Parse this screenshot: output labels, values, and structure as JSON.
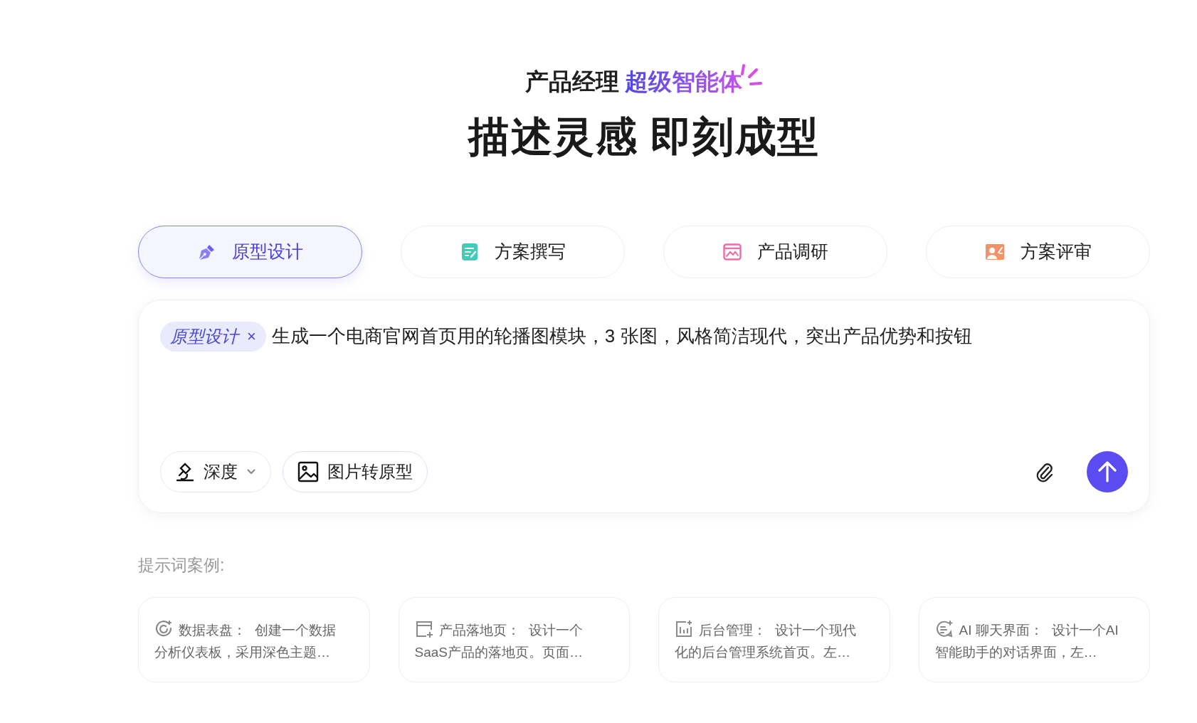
{
  "header": {
    "tagline_plain": "产品经理",
    "tagline_gradient": "超级智能体",
    "title": "描述灵感 即刻成型"
  },
  "tabs": [
    {
      "label": "原型设计",
      "selected": true
    },
    {
      "label": "方案撰写",
      "selected": false
    },
    {
      "label": "产品调研",
      "selected": false
    },
    {
      "label": "方案评审",
      "selected": false
    }
  ],
  "composer": {
    "chip": "原型设计",
    "chip_close": "×",
    "value": "生成一个电商官网首页用的轮播图模块，3 张图，风格简洁现代，突出产品优势和按钮",
    "mode": "深度",
    "image_button": "图片转原型"
  },
  "examples_label": "提示词案例:",
  "examples": [
    {
      "title": "数据表盘：",
      "text": "创建一个数据分析仪表板，采用深色主题…"
    },
    {
      "title": "产品落地页：",
      "text": "设计一个SaaS产品的落地页。页面…"
    },
    {
      "title": "后台管理：",
      "text": "设计一个现代化的后台管理系统首页。左…"
    },
    {
      "title": "AI 聊天界面：",
      "text": "设计一个AI智能助手的对话界面，左…"
    }
  ]
}
